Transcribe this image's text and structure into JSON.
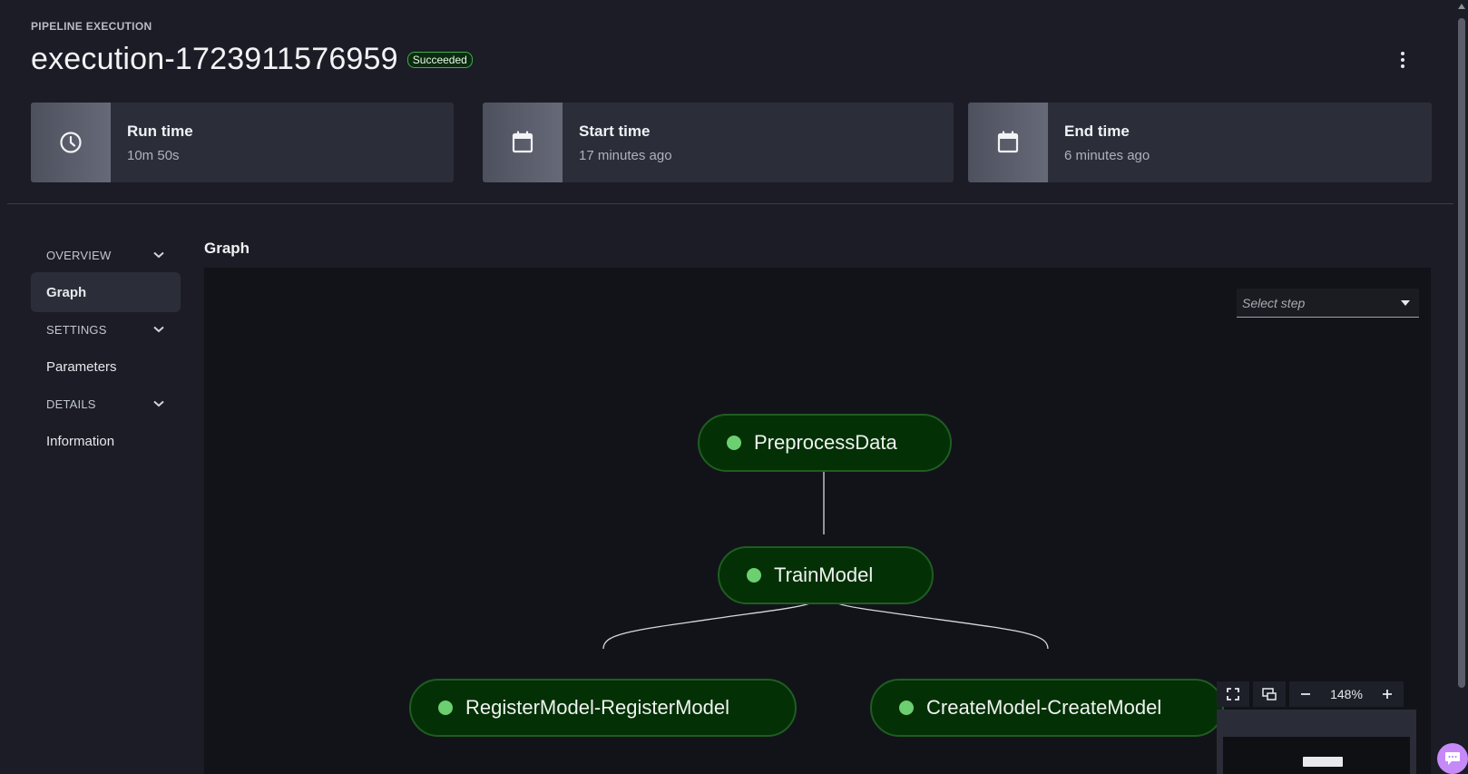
{
  "header": {
    "eyebrow": "PIPELINE EXECUTION",
    "title": "execution-1723911576959",
    "status": "Succeeded"
  },
  "cards": [
    {
      "label": "Run time",
      "value": "10m 50s",
      "icon": "clock-icon"
    },
    {
      "label": "Start time",
      "value": "17 minutes ago",
      "icon": "calendar-icon"
    },
    {
      "label": "End time",
      "value": "6 minutes ago",
      "icon": "calendar-icon"
    }
  ],
  "sidenav": {
    "overview": "OVERVIEW",
    "graph": "Graph",
    "settings": "SETTINGS",
    "parameters": "Parameters",
    "details": "DETAILS",
    "information": "Information"
  },
  "graph": {
    "title": "Graph",
    "select_placeholder": "Select step",
    "nodes": {
      "preprocess": "PreprocessData",
      "train": "TrainModel",
      "register": "RegisterModel-RegisterModel",
      "create": "CreateModel-CreateModel"
    },
    "zoom": "148%"
  },
  "colors": {
    "background": "#1b1c25",
    "canvas": "#121318",
    "node_fill": "#043006",
    "node_border": "#1f5d22",
    "status_dot": "#6ccf70",
    "badge_border": "#3fae49"
  }
}
